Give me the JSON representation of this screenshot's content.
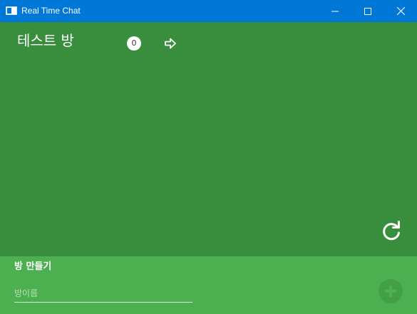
{
  "window": {
    "title": "Real Time Chat",
    "icons": {
      "app": "app-window-icon",
      "minimize": "minimize-icon",
      "maximize": "maximize-icon",
      "close": "close-icon"
    }
  },
  "rooms": [
    {
      "name": "테스트 방",
      "count": "0"
    }
  ],
  "create": {
    "title": "방 만들기",
    "placeholder": "방이름",
    "value": ""
  },
  "colors": {
    "titlebar": "#0078d7",
    "main_bg": "#388e3c",
    "panel_bg": "#4caf50",
    "add_button": "#43a047"
  }
}
